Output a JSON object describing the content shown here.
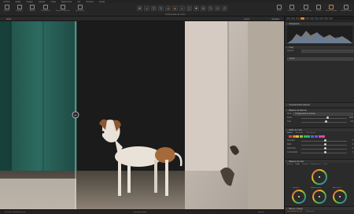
{
  "menu": [
    "Archivo",
    "Editar",
    "Imagen",
    "Ajustes",
    "Capa",
    "Seleccionar",
    "Ver",
    "Ventana",
    "Ayuda"
  ],
  "toolbar_left": [
    {
      "label": "Importar",
      "icon": "import-icon"
    },
    {
      "label": "Exportar",
      "icon": "export-icon"
    },
    {
      "label": "Capturar",
      "icon": "camera-icon"
    },
    {
      "label": "Restablecer",
      "icon": "reset-icon"
    },
    {
      "label": "Deshacer/Rehacer",
      "icon": "undo-icon"
    },
    {
      "label": "Auto ajuste",
      "icon": "auto-adjust-icon"
    }
  ],
  "tools_label": "Herramientas del cursor",
  "toolbar_right": [
    {
      "label": "Hacer",
      "icon": "grid-icon"
    },
    {
      "label": "Cuadrícula",
      "icon": "grid-lines-icon"
    },
    {
      "label": "Avisos de expo",
      "icon": "warning-icon"
    },
    {
      "label": "Prueba",
      "icon": "proof-icon"
    },
    {
      "label": "Sólo búsqueda",
      "icon": "search-icon"
    },
    {
      "label": "Cámara Previa",
      "icon": "preview-icon"
    }
  ],
  "viewer": {
    "before_label": "Antes",
    "after_label": "Después",
    "zoom_label": "Ajustar"
  },
  "status": {
    "left": "f/4   1/125 s   ISO 800   55 mm",
    "center": "Pantalla dividida",
    "right": "Recorte"
  },
  "panel": {
    "histogram": "Histograma",
    "crop": "Crop",
    "crop_rows": [
      {
        "label": "Aspecto",
        "value": ""
      }
    ],
    "crop_button": "Frame",
    "basic": "Características básicas",
    "white_balance": "Balance de blancos",
    "wb_mode_label": "Modo",
    "wb_mode": "Configuración de cámara",
    "wb_rows": [
      {
        "label": "Kelvin",
        "value": "5403"
      },
      {
        "label": "Tinte",
        "value": "2.9"
      }
    ],
    "color_editor": "Editor de color",
    "color_editor_tabs": [
      "Básico",
      "Avanzado",
      "Tono de piel"
    ],
    "color_editor_rows": [
      {
        "label": "Suavidad",
        "value": "0"
      },
      {
        "label": "Matiz",
        "value": "0"
      },
      {
        "label": "Saturación",
        "value": "0"
      },
      {
        "label": "Luminosidad",
        "value": "0"
      }
    ],
    "swatch_colors": [
      "#d44",
      "#e07d2a",
      "#e0c030",
      "#8bc34a",
      "#3fb24f",
      "#2aa8a8",
      "#3b6fd6",
      "#7a4fd6",
      "#c04fc0",
      "#e05080"
    ],
    "color_balance": "Balance de color",
    "cb_tabs": [
      "Maestro",
      "3 vías",
      "Sombras",
      "Medios tonos",
      "Luces"
    ],
    "wheel_labels": [
      "Sombras",
      "Medios tonos",
      "Altas luces"
    ],
    "bw": "Blanco y Negro",
    "bw_tabs": [
      "Sensibilidad de color",
      "Tonificación"
    ],
    "bw_sub": "Highlights Shadows y Saturación"
  }
}
